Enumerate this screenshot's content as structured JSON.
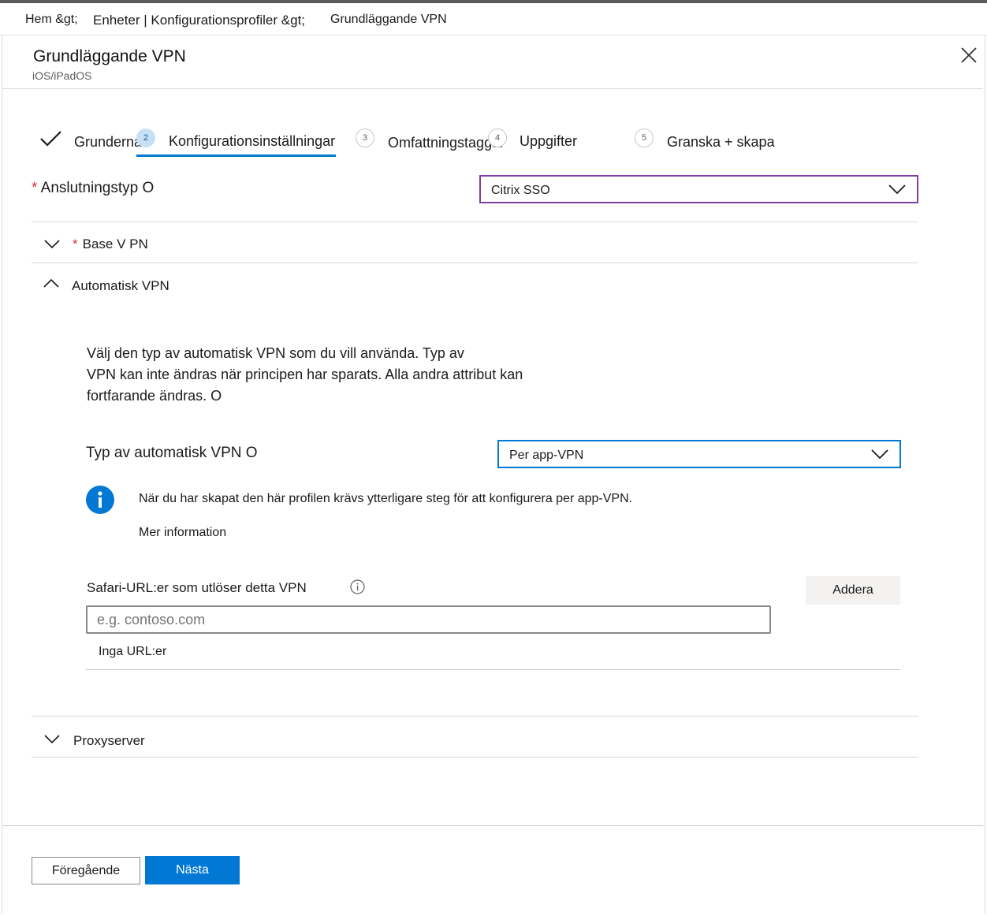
{
  "breadcrumb": {
    "home": "Hem &gt;",
    "devices": "Enheter | Konfigurationsprofiler &gt;",
    "current": "Grundläggande VPN"
  },
  "header": {
    "title": "Grundläggande VPN",
    "platform": "iOS/iPadOS",
    "close_icon": "close-icon"
  },
  "wizard": {
    "steps": [
      {
        "number": "",
        "label": "Grunderna",
        "state": "completed"
      },
      {
        "number": "2",
        "label": "Konfigurationsinställningar",
        "state": "active"
      },
      {
        "number": "3",
        "label": "Omfattningstaggar",
        "state": "pending"
      },
      {
        "number": "4",
        "label": "Uppgifter",
        "state": "pending"
      },
      {
        "number": "5",
        "label": "Granska + skapa",
        "state": "pending"
      }
    ]
  },
  "connection_type": {
    "label": "Anslutningstyp O",
    "value": "Citrix SSO"
  },
  "sections": {
    "base_vpn": "Base V PN",
    "automatic_vpn": "Automatisk VPN",
    "proxy": "Proxyserver"
  },
  "auto_vpn": {
    "description_line1": "Välj den typ av automatisk VPN som du vill använda. Typ av",
    "description_line2": "VPN kan inte ändras när principen har sparats. Alla andra attribut kan",
    "description_line3": "fortfarande ändras. O",
    "type_label": "Typ av automatisk VPN O",
    "type_value": "Per app-VPN",
    "info_text": "När du har skapat den här profilen krävs ytterligare steg för att konfigurera per app-VPN.",
    "more_info": "Mer information",
    "safari_label": "Safari-URL:er som utlöser detta VPN",
    "add_button": "Addera",
    "url_placeholder": "e.g. contoso.com",
    "no_urls": "Inga URL:er"
  },
  "footer": {
    "previous": "Föregående",
    "next": "Nästa"
  },
  "colors": {
    "accent": "#0078d4",
    "focus_purple": "#7f3f9f",
    "required": "#d13438",
    "active_step_circle": "#c7e0f4"
  }
}
